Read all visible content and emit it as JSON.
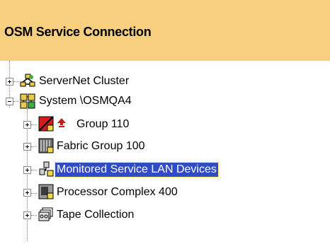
{
  "header": {
    "title": "OSM Service Connection"
  },
  "tree": {
    "nodes": [
      {
        "label": "ServerNet Cluster",
        "icon": "servernet-cluster-icon",
        "expander": "plus"
      },
      {
        "label": "System \\OSMQA4",
        "icon": "system-icon",
        "expander": "minus"
      },
      {
        "label": "Group 110",
        "icon": "group-icon",
        "alert_icon": "alarm-icon",
        "expander": "plus"
      },
      {
        "label": "Fabric Group 100",
        "icon": "fabric-group-icon",
        "expander": "plus"
      },
      {
        "label": "Monitored Service LAN Devices",
        "icon": "lan-devices-icon",
        "expander": "plus",
        "selected": true
      },
      {
        "label": "Processor Complex 400",
        "icon": "processor-complex-icon",
        "expander": "plus"
      },
      {
        "label": "Tape Collection",
        "icon": "tape-collection-icon",
        "expander": "plus"
      }
    ]
  },
  "colors": {
    "header_bg": "#f8cf7e",
    "selection_bg": "#2f4cc6",
    "selection_text": "#ffffff"
  }
}
